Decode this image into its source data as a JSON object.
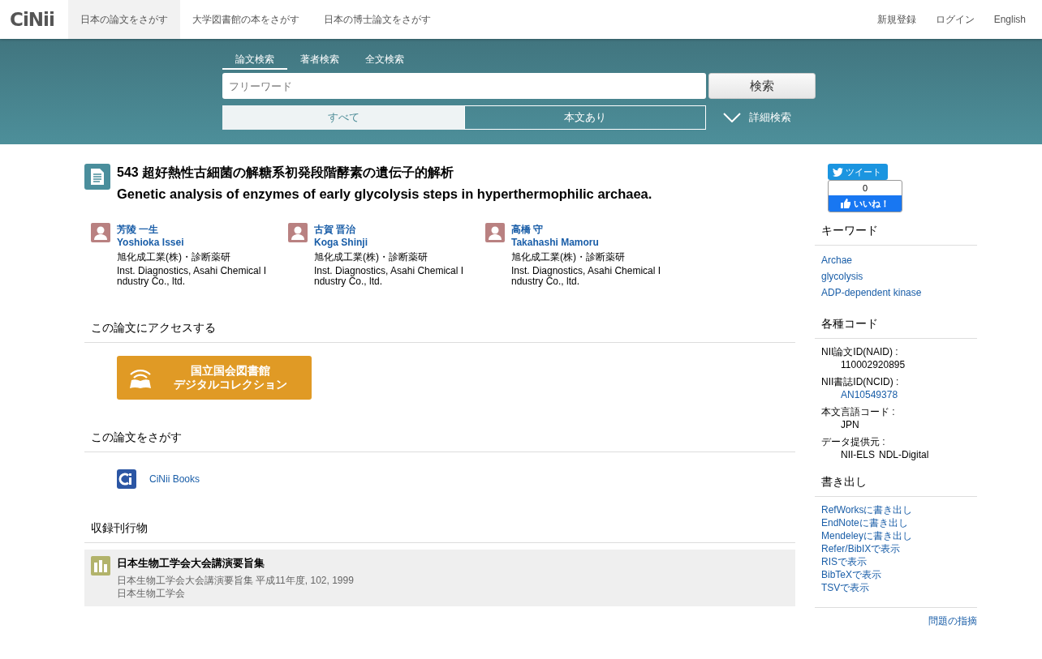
{
  "header": {
    "logo": "CiNii",
    "nav": [
      {
        "label": "日本の論文をさがす",
        "selected": true
      },
      {
        "label": "大学図書館の本をさがす",
        "selected": false
      },
      {
        "label": "日本の博士論文をさがす",
        "selected": false
      }
    ],
    "account_links": [
      "新規登録",
      "ログイン",
      "English"
    ]
  },
  "search": {
    "tabs": [
      {
        "label": "論文検索",
        "selected": true
      },
      {
        "label": "著者検索",
        "selected": false
      },
      {
        "label": "全文検索",
        "selected": false
      }
    ],
    "placeholder": "フリーワード",
    "button": "検索",
    "filters": [
      {
        "label": "すべて",
        "selected": true
      },
      {
        "label": "本文あり",
        "selected": false
      }
    ],
    "advanced": "詳細検索"
  },
  "article": {
    "title_ja": "543 超好熱性古細菌の解糖系初発段階酵素の遺伝子的解析",
    "title_en": "Genetic analysis of enzymes of early glycolysis steps in hyperthermophilic archaea.",
    "authors": [
      {
        "name_ja": "芳陵 一生",
        "name_en": "Yoshioka Issei",
        "affiliation_ja": "旭化成工業(株)・診断薬研",
        "affiliation_en": "Inst. Diagnostics, Asahi Chemical Industry Co., ltd."
      },
      {
        "name_ja": "古賀 晋治",
        "name_en": "Koga Shinji",
        "affiliation_ja": "旭化成工業(株)・診断薬研",
        "affiliation_en": "Inst. Diagnostics, Asahi Chemical Industry Co., ltd."
      },
      {
        "name_ja": "高橋 守",
        "name_en": "Takahashi Mamoru",
        "affiliation_ja": "旭化成工業(株)・診断薬研",
        "affiliation_en": "Inst. Diagnostics, Asahi Chemical Industry Co., ltd."
      }
    ],
    "access": {
      "heading": "この論文にアクセスする",
      "button_lines": [
        "国立国会図書館",
        "デジタルコレクション"
      ]
    },
    "find": {
      "heading": "この論文をさがす",
      "link": "CiNii Books"
    },
    "journal": {
      "heading": "収録刊行物",
      "title": "日本生物工学会大会講演要旨集",
      "details": "日本生物工学会大会講演要旨集 平成11年度, 102, 1999",
      "publisher": "日本生物工学会"
    }
  },
  "sidebar": {
    "tweet": "ツイート",
    "like_count": "0",
    "like": "いいね！",
    "keywords": {
      "heading": "キーワード",
      "items": [
        "Archae",
        "glycolysis",
        "ADP-dependent kinase"
      ]
    },
    "codes": {
      "heading": "各種コード",
      "items": [
        {
          "label": "NII論文ID(NAID) :",
          "kind": "text",
          "values": [
            "110002920895"
          ]
        },
        {
          "label": "NII書誌ID(NCID) :",
          "kind": "link",
          "values": [
            "AN10549378"
          ]
        },
        {
          "label": "本文言語コード :",
          "kind": "text",
          "values": [
            "JPN"
          ]
        },
        {
          "label": "データ提供元 :",
          "kind": "text",
          "values": [
            "NII-ELS",
            "NDL-Digital"
          ]
        }
      ]
    },
    "export": {
      "heading": "書き出し",
      "items": [
        "RefWorksに書き出し",
        "EndNoteに書き出し",
        "Mendeleyに書き出し",
        "Refer/BibIXで表示",
        "RISで表示",
        "BibTeXで表示",
        "TSVで表示"
      ]
    },
    "report": "問題の指摘"
  }
}
